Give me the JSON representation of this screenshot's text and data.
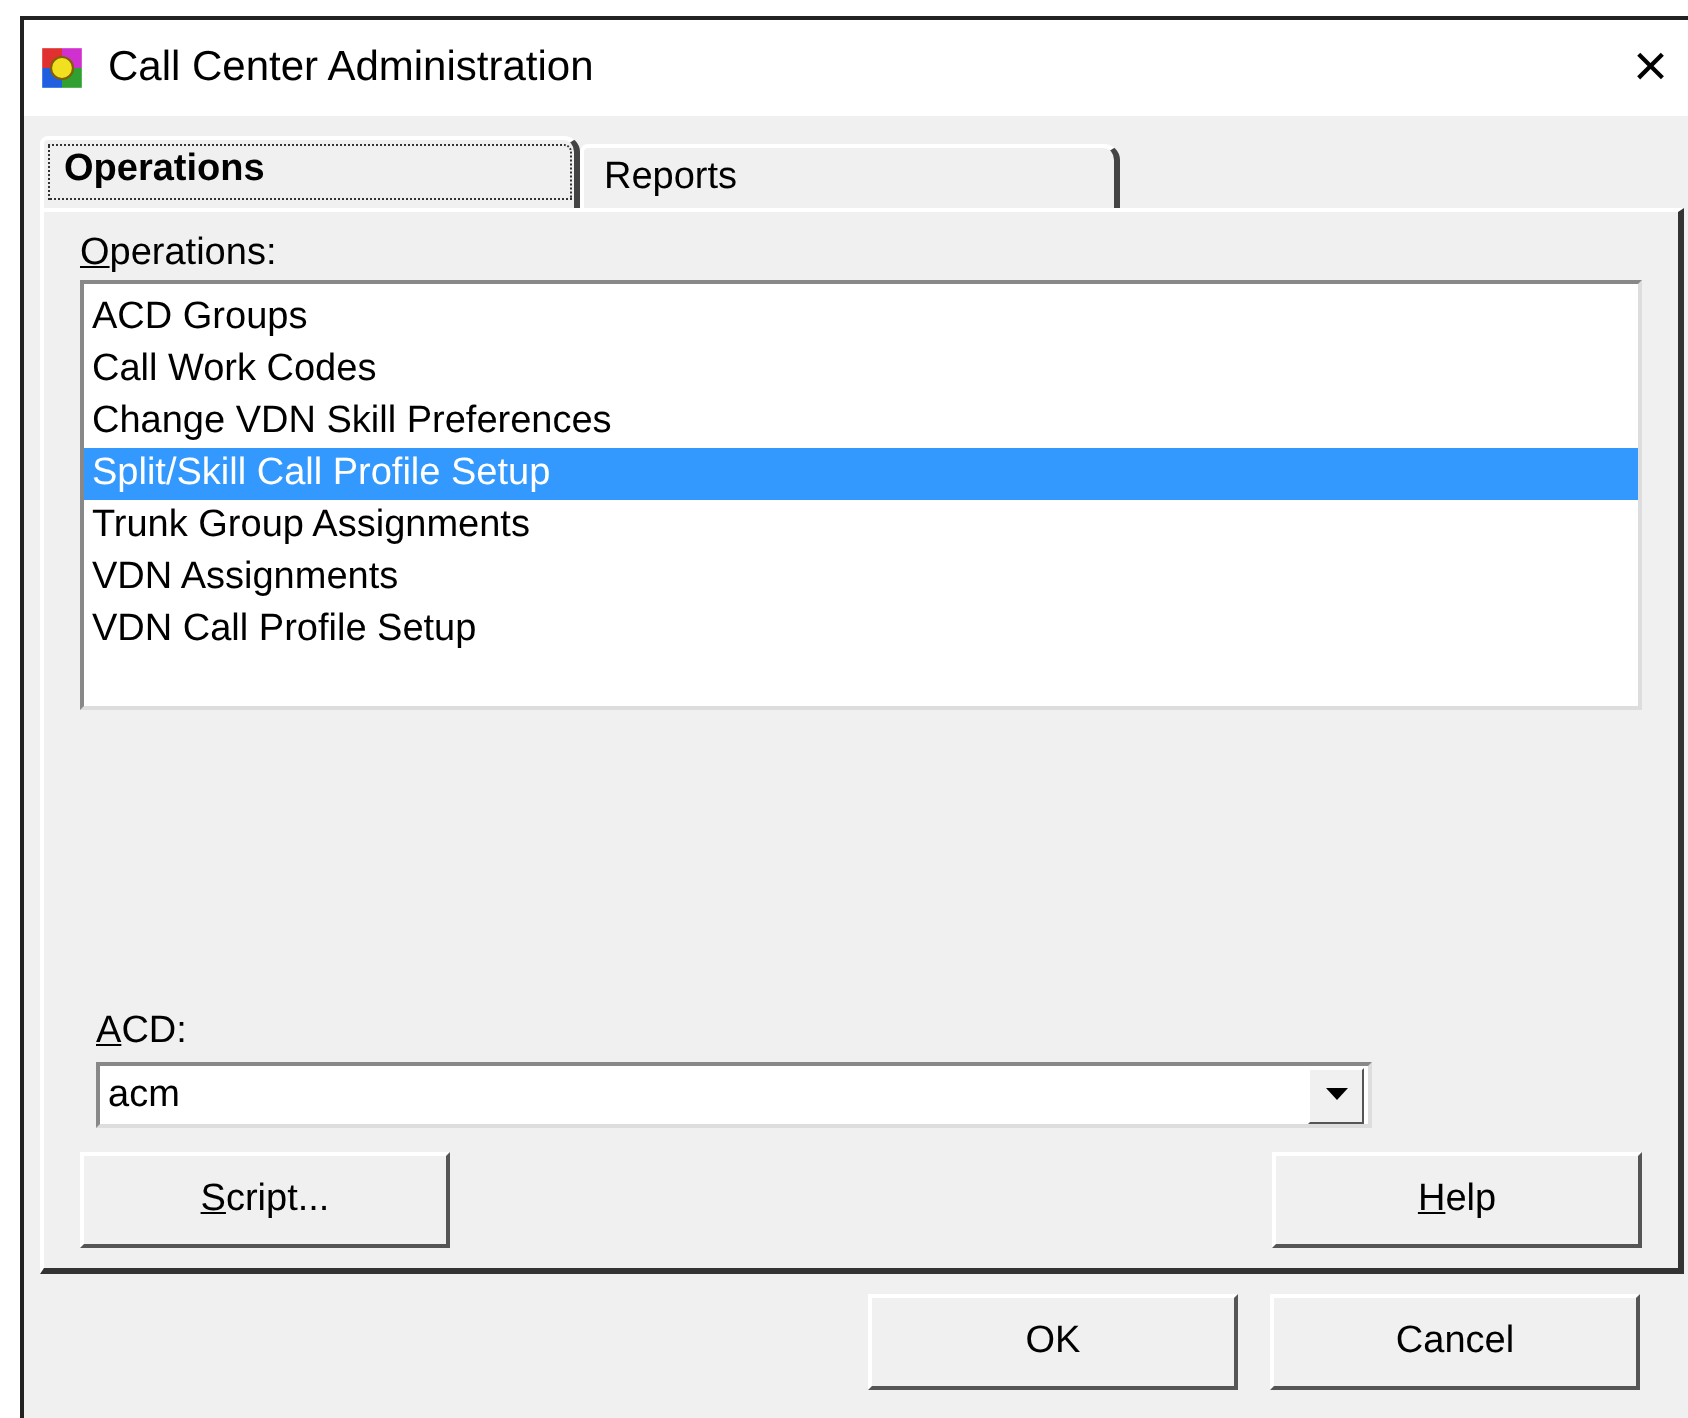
{
  "window": {
    "title": "Call Center Administration",
    "close": "×"
  },
  "tabs": [
    {
      "label": "Operations",
      "selected": true
    },
    {
      "label": "Reports",
      "selected": false
    }
  ],
  "operations": {
    "label": "Operations:",
    "items": [
      {
        "label": "ACD Groups",
        "selected": false
      },
      {
        "label": "Call Work Codes",
        "selected": false
      },
      {
        "label": "Change VDN Skill Preferences",
        "selected": false
      },
      {
        "label": "Split/Skill Call Profile Setup",
        "selected": true
      },
      {
        "label": "Trunk Group Assignments",
        "selected": false
      },
      {
        "label": "VDN Assignments",
        "selected": false
      },
      {
        "label": "VDN Call Profile Setup",
        "selected": false
      }
    ]
  },
  "acd": {
    "label": "ACD:",
    "value": "acm"
  },
  "panel_buttons": [
    "Script...",
    "Help"
  ],
  "dialog_buttons": [
    "OK",
    "Cancel"
  ]
}
